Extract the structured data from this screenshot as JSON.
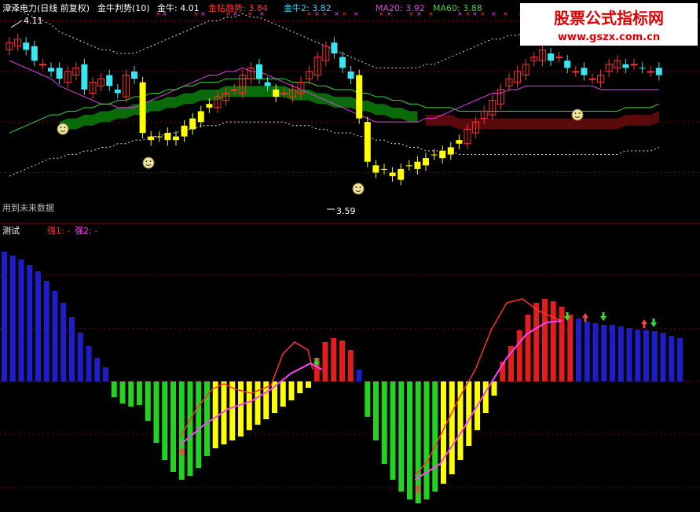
{
  "top_panel": {
    "stock_name": "漳泽电力(日线 前复权)",
    "indicator_name": "金牛判势(10)",
    "items": [
      {
        "label": "金牛: 4.01",
        "color": "#ffffff"
      },
      {
        "label": "金钻趋势: 3.84",
        "color": "#ff3030"
      },
      {
        "label": "金牛2: 3.82",
        "color": "#37d7ff"
      },
      {
        "label": "MA20: 3.92",
        "color": "#e040e0"
      },
      {
        "label": "MA60: 3.88",
        "color": "#3cd23c"
      }
    ],
    "high_label": "4.11",
    "low_label": "3.59",
    "future_data_note": "用到未来数据"
  },
  "bottom_panel": {
    "title": "测试",
    "legend_1": "强1: -",
    "legend_2": "强2: -",
    "legend_1_color": "#ff3030",
    "legend_2_color": "#ff40ff"
  },
  "watermark": {
    "title": "股票公式指标网",
    "url": "www.gszx.com.cn",
    "color": "#e00000"
  },
  "chart_data": [
    {
      "type": "candlestick",
      "title": "漳泽电力(日线 前复权)",
      "series": [
        {
          "name": "MA20",
          "values": [
            4.0,
            3.99,
            3.98,
            3.97,
            3.96,
            3.95,
            3.93,
            3.92,
            3.91,
            3.9,
            3.89,
            3.88,
            3.88,
            3.87,
            3.87,
            3.87,
            3.88,
            3.89,
            3.9,
            3.91,
            3.92,
            3.93,
            3.94,
            3.95,
            3.96,
            3.96,
            3.97,
            3.97,
            3.98,
            3.97,
            3.97,
            3.96,
            3.95,
            3.94,
            3.93,
            3.92,
            3.91,
            3.9,
            3.89,
            3.88,
            3.87,
            3.86,
            3.85,
            3.84,
            3.83,
            3.83,
            3.83,
            3.83,
            3.83,
            3.83,
            3.84,
            3.84,
            3.85,
            3.86,
            3.87,
            3.88,
            3.89,
            3.9,
            3.91,
            3.91,
            3.92,
            3.92,
            3.93,
            3.93,
            3.93,
            3.93,
            3.93,
            3.93,
            3.93,
            3.93,
            3.93,
            3.92,
            3.92,
            3.92,
            3.92,
            3.92,
            3.92,
            3.92,
            3.92
          ]
        },
        {
          "name": "MA60",
          "values": [
            3.8,
            3.81,
            3.82,
            3.83,
            3.84,
            3.85,
            3.85,
            3.86,
            3.86,
            3.87,
            3.87,
            3.88,
            3.88,
            3.89,
            3.89,
            3.9,
            3.9,
            3.91,
            3.91,
            3.92,
            3.92,
            3.93,
            3.93,
            3.94,
            3.94,
            3.94,
            3.95,
            3.95,
            3.95,
            3.95,
            3.95,
            3.95,
            3.95,
            3.95,
            3.94,
            3.94,
            3.94,
            3.93,
            3.93,
            3.92,
            3.92,
            3.92,
            3.91,
            3.91,
            3.9,
            3.9,
            3.89,
            3.89,
            3.88,
            3.88,
            3.87,
            3.87,
            3.87,
            3.87,
            3.86,
            3.86,
            3.86,
            3.86,
            3.86,
            3.86,
            3.86,
            3.86,
            3.86,
            3.86,
            3.86,
            3.86,
            3.86,
            3.86,
            3.86,
            3.86,
            3.86,
            3.86,
            3.86,
            3.86,
            3.87,
            3.87,
            3.87,
            3.87,
            3.88
          ]
        }
      ]
    },
    {
      "type": "bar",
      "title": "测试",
      "series": [
        {
          "name": "强1",
          "values": []
        },
        {
          "name": "强2",
          "values": []
        }
      ]
    }
  ]
}
